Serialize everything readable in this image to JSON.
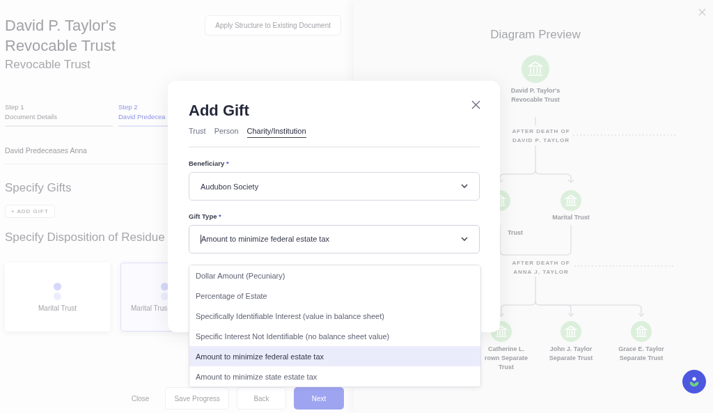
{
  "page": {
    "title": "David P. Taylor's Revocable Trust",
    "subtitle": "Revocable Trust",
    "apply_button": "Apply Structure to Existing Document",
    "steps": [
      {
        "step": "Step 1",
        "name": "Document Details",
        "selected": false
      },
      {
        "step": "Step 2",
        "name": "David Predecea",
        "selected": true
      }
    ],
    "scenario": "David Predeceases Anna",
    "gifts_heading": "Specify Gifts",
    "add_gift_button": "+ ADD GIFT",
    "residue_heading": "Specify Disposition of Residue",
    "residue_cards": [
      {
        "label": "Marital Trust",
        "selected": false
      },
      {
        "label": "Marital Trus",
        "selected": true
      }
    ],
    "footer_buttons": [
      {
        "label": "Close",
        "kind": "text"
      },
      {
        "label": "Save Progress",
        "kind": "outline"
      },
      {
        "label": "Back",
        "kind": "outline"
      },
      {
        "label": "Next",
        "kind": "primary"
      }
    ]
  },
  "diagram": {
    "title": "Diagram Preview",
    "nodes": [
      {
        "label": "David P. Taylor's Revocable Trust"
      },
      {
        "label": "Trust"
      },
      {
        "label": "Marital Trust"
      },
      {
        "label": "Catherine L. rown Separate Trust"
      },
      {
        "label": "John J. Taylor Separate Trust"
      },
      {
        "label": "Grace E. Taylor Separate Trust"
      }
    ],
    "events": [
      "AFTER DEATH OF DAVID P. TAYLOR",
      "AFTER DEATH OF ANNA J. TAYLOR"
    ]
  },
  "modal": {
    "title": "Add Gift",
    "tabs": [
      {
        "label": "Trust",
        "selected": false
      },
      {
        "label": "Person",
        "selected": false
      },
      {
        "label": "Charity/Institution",
        "selected": true
      }
    ],
    "fields": [
      {
        "label": "Beneficiary",
        "required_mark": "*",
        "value": "Audubon Society",
        "expanded": false
      },
      {
        "label": "Gift Type",
        "required_mark": "*",
        "value": "Amount to minimize federal estate tax",
        "expanded": true,
        "options": [
          {
            "label": "Dollar Amount (Pecuniary)",
            "selected": false
          },
          {
            "label": "Percentage of Estate",
            "selected": false
          },
          {
            "label": "Specifically Identifiable Interest (value in balance sheet)",
            "selected": false
          },
          {
            "label": "Specific Interest Not Identifiable (no balance sheet value)",
            "selected": false
          },
          {
            "label": "Amount to minimize federal estate tax",
            "selected": true
          },
          {
            "label": "Amount to minimize state estate tax",
            "selected": false
          }
        ]
      }
    ]
  }
}
